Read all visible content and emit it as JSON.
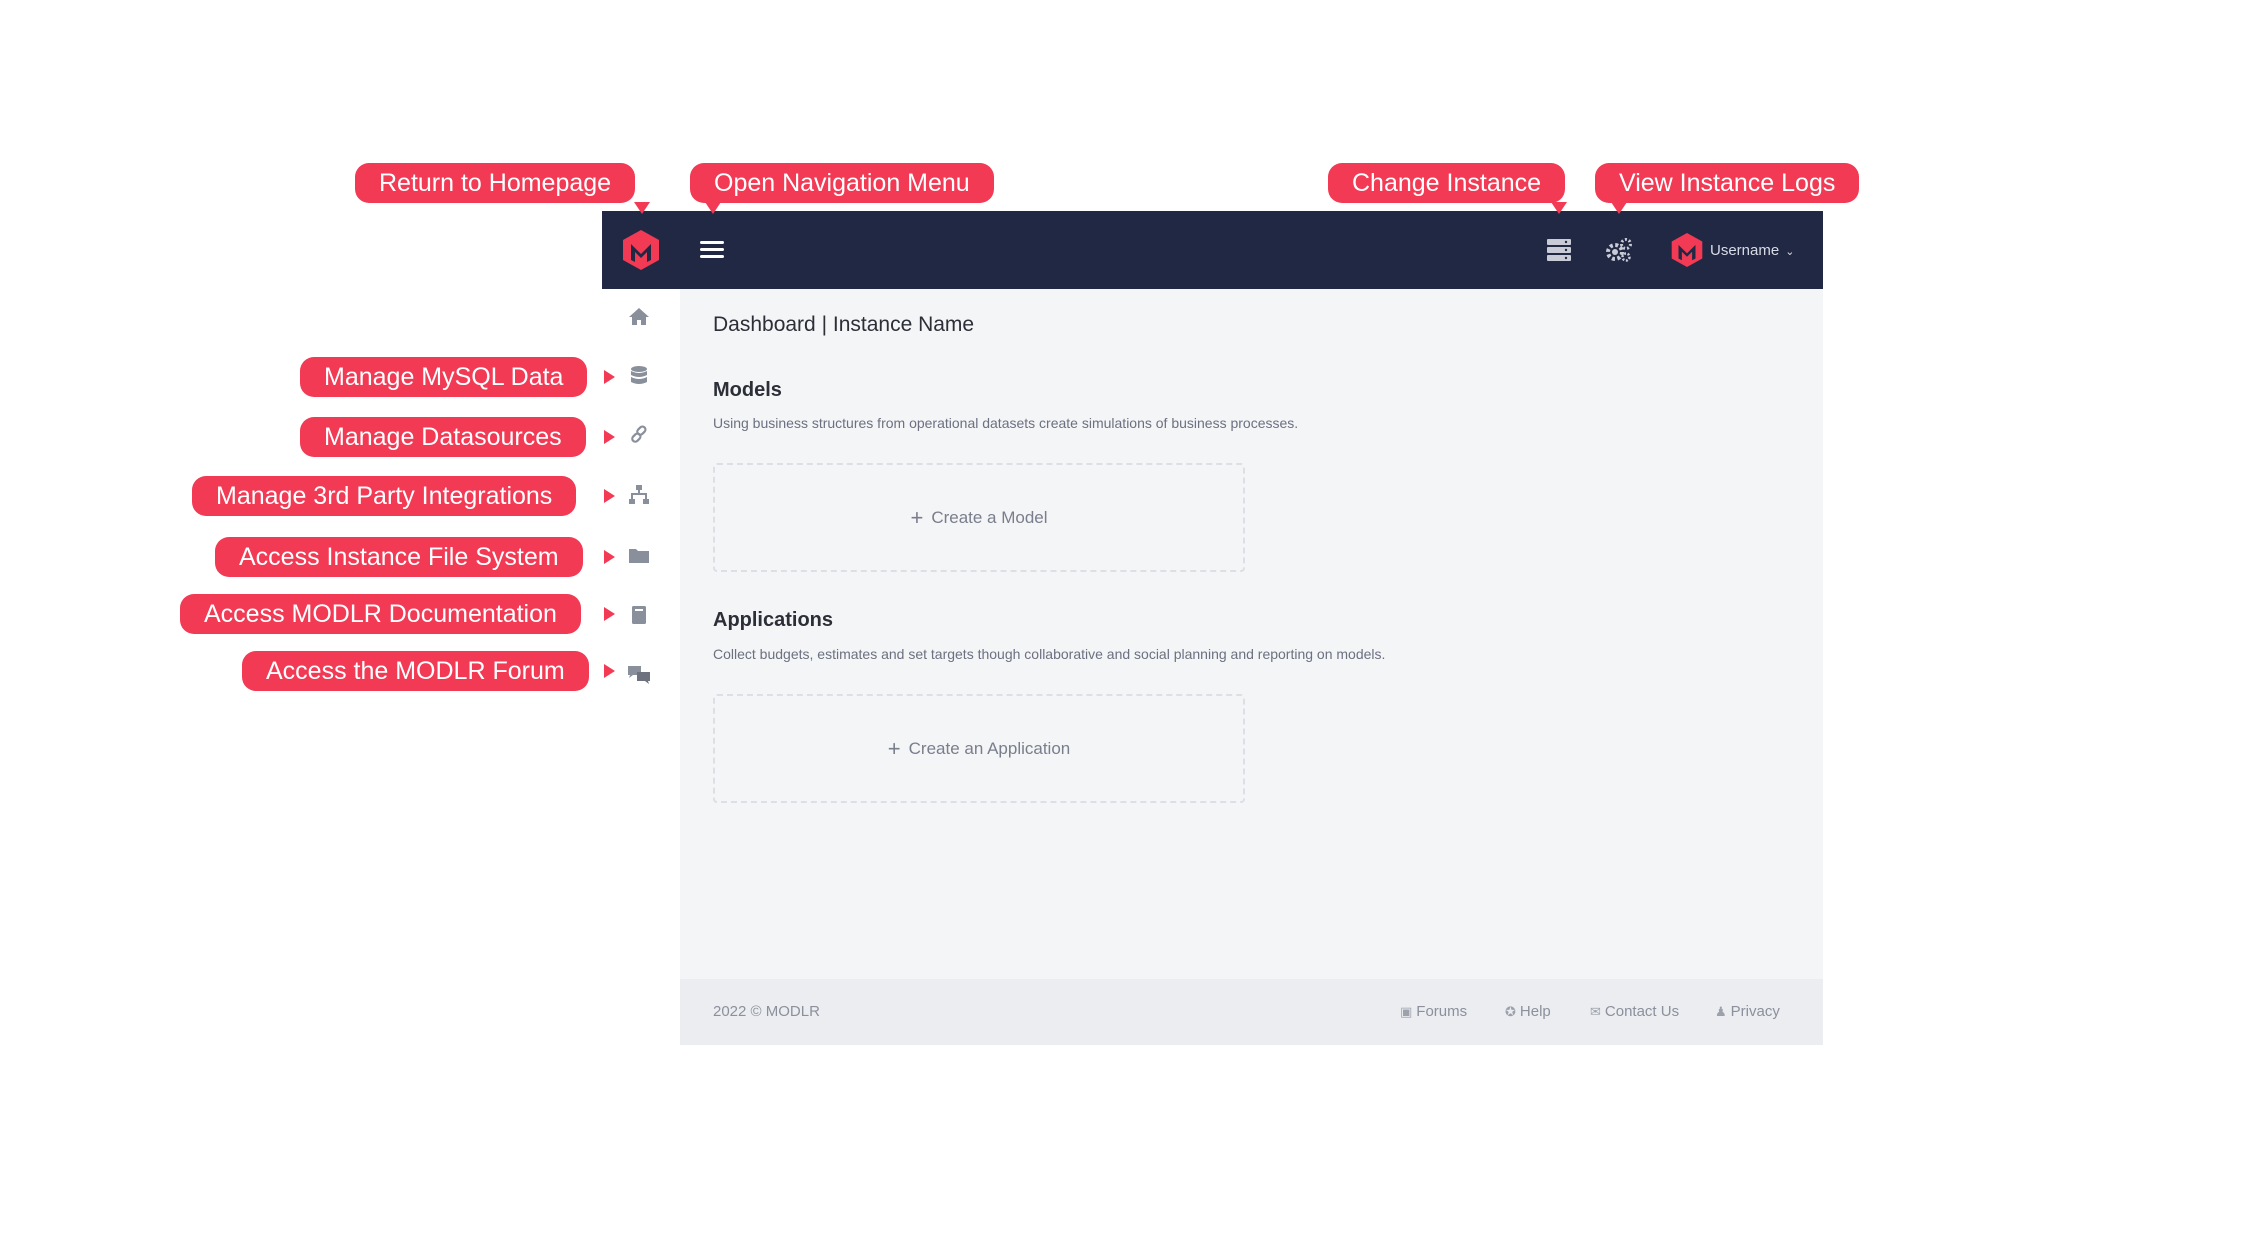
{
  "header": {
    "username": "Username",
    "chevron": "⌄",
    "icons": [
      "modlr-logo",
      "hamburger-menu-icon",
      "server-icon",
      "gears-icon",
      "user-avatar"
    ]
  },
  "sidebar": {
    "icons": [
      "home-icon",
      "database-icon",
      "link-icon",
      "sitemap-icon",
      "folder-icon",
      "book-icon",
      "comments-icon"
    ]
  },
  "main": {
    "title": "Dashboard | Instance Name",
    "models": {
      "heading": "Models",
      "description": "Using business structures from operational datasets create simulations of business processes.",
      "create_label": "Create a Model"
    },
    "applications": {
      "heading": "Applications",
      "description": "Collect budgets, estimates and set targets though collaborative and social planning and reporting on models.",
      "create_label": "Create an Application"
    },
    "plus": "+"
  },
  "footer": {
    "copyright": "2022 © MODLR",
    "links": {
      "forums": "Forums",
      "help": "Help",
      "contact": "Contact Us",
      "privacy": "Privacy"
    }
  },
  "callouts": {
    "homepage": "Return to Homepage",
    "nav_menu": "Open Navigation Menu",
    "change_instance": "Change Instance",
    "view_logs": "View Instance Logs",
    "mysql": "Manage MySQL Data",
    "datasources": "Manage Datasources",
    "integrations": "Manage 3rd Party Integrations",
    "filesystem": "Access Instance File System",
    "documentation": "Access MODLR Documentation",
    "forum": "Access the MODLR Forum"
  },
  "colors": {
    "topbar": "#212843",
    "brand": "#f23a55",
    "content_bg": "#f4f5f7"
  }
}
